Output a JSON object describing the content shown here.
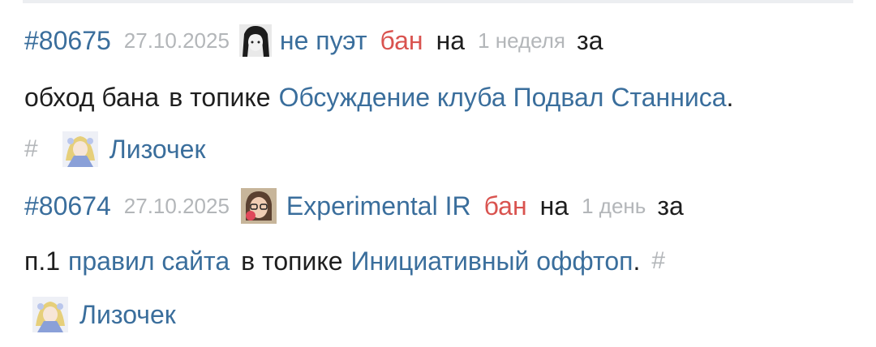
{
  "entries": [
    {
      "id": "#80675",
      "date": "27.10.2025",
      "user": "не пуэт",
      "action": "бан",
      "on_word": "на",
      "duration": "1 неделя",
      "for_word": "за",
      "reason_pre": "обход бана",
      "in_topic_word": "в топике",
      "topic": "Обсуждение клуба Подвал Станниса",
      "topic_end": ".",
      "hash": "#",
      "moderator": "Лизочек"
    },
    {
      "id": "#80674",
      "date": "27.10.2025",
      "user": "Experimental IR",
      "action": "бан",
      "on_word": "на",
      "duration": "1 день",
      "for_word": "за",
      "reason_pre": "п.1",
      "reason_link": "правил сайта",
      "in_topic_word": "в топике",
      "topic": "Инициативный оффтоп",
      "topic_end": ".",
      "hash": "#",
      "moderator": "Лизочек"
    }
  ],
  "colors": {
    "link": "#3a6e9c",
    "ban": "#d9534f",
    "muted": "#b3b6b9",
    "text": "#1e1e1e"
  }
}
